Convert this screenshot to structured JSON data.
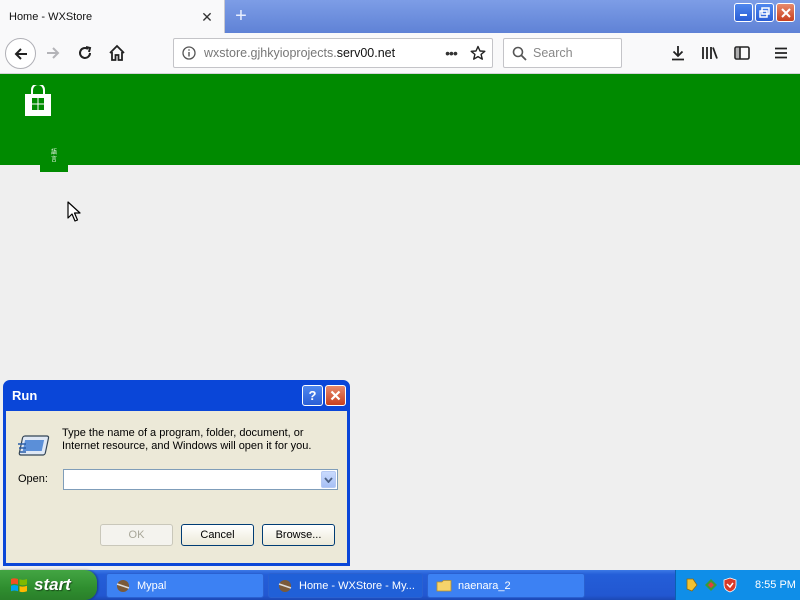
{
  "browser": {
    "tab_title": "Home - WXStore",
    "new_tab_label": "+",
    "url_prefix": "wxstore.gjhkyioprojects.",
    "url_domain": "serv00.net",
    "url_more": "•••",
    "search_placeholder": "Search"
  },
  "page": {
    "header_color": "#008a00",
    "nav_tile_label": "語言"
  },
  "run_dialog": {
    "title": "Run",
    "help_label": "?",
    "description": "Type the name of a program, folder, document, or Internet resource, and Windows will open it for you.",
    "open_label": "Open:",
    "open_value": "",
    "ok_label": "OK",
    "cancel_label": "Cancel",
    "browse_label": "Browse..."
  },
  "taskbar": {
    "start_label": "start",
    "items": [
      {
        "label": "Mypal",
        "icon": "browser-icon"
      },
      {
        "label": "Home - WXStore - My...",
        "icon": "browser-icon"
      },
      {
        "label": "naenara_2",
        "icon": "folder-icon"
      }
    ],
    "clock": "8:55 PM"
  }
}
